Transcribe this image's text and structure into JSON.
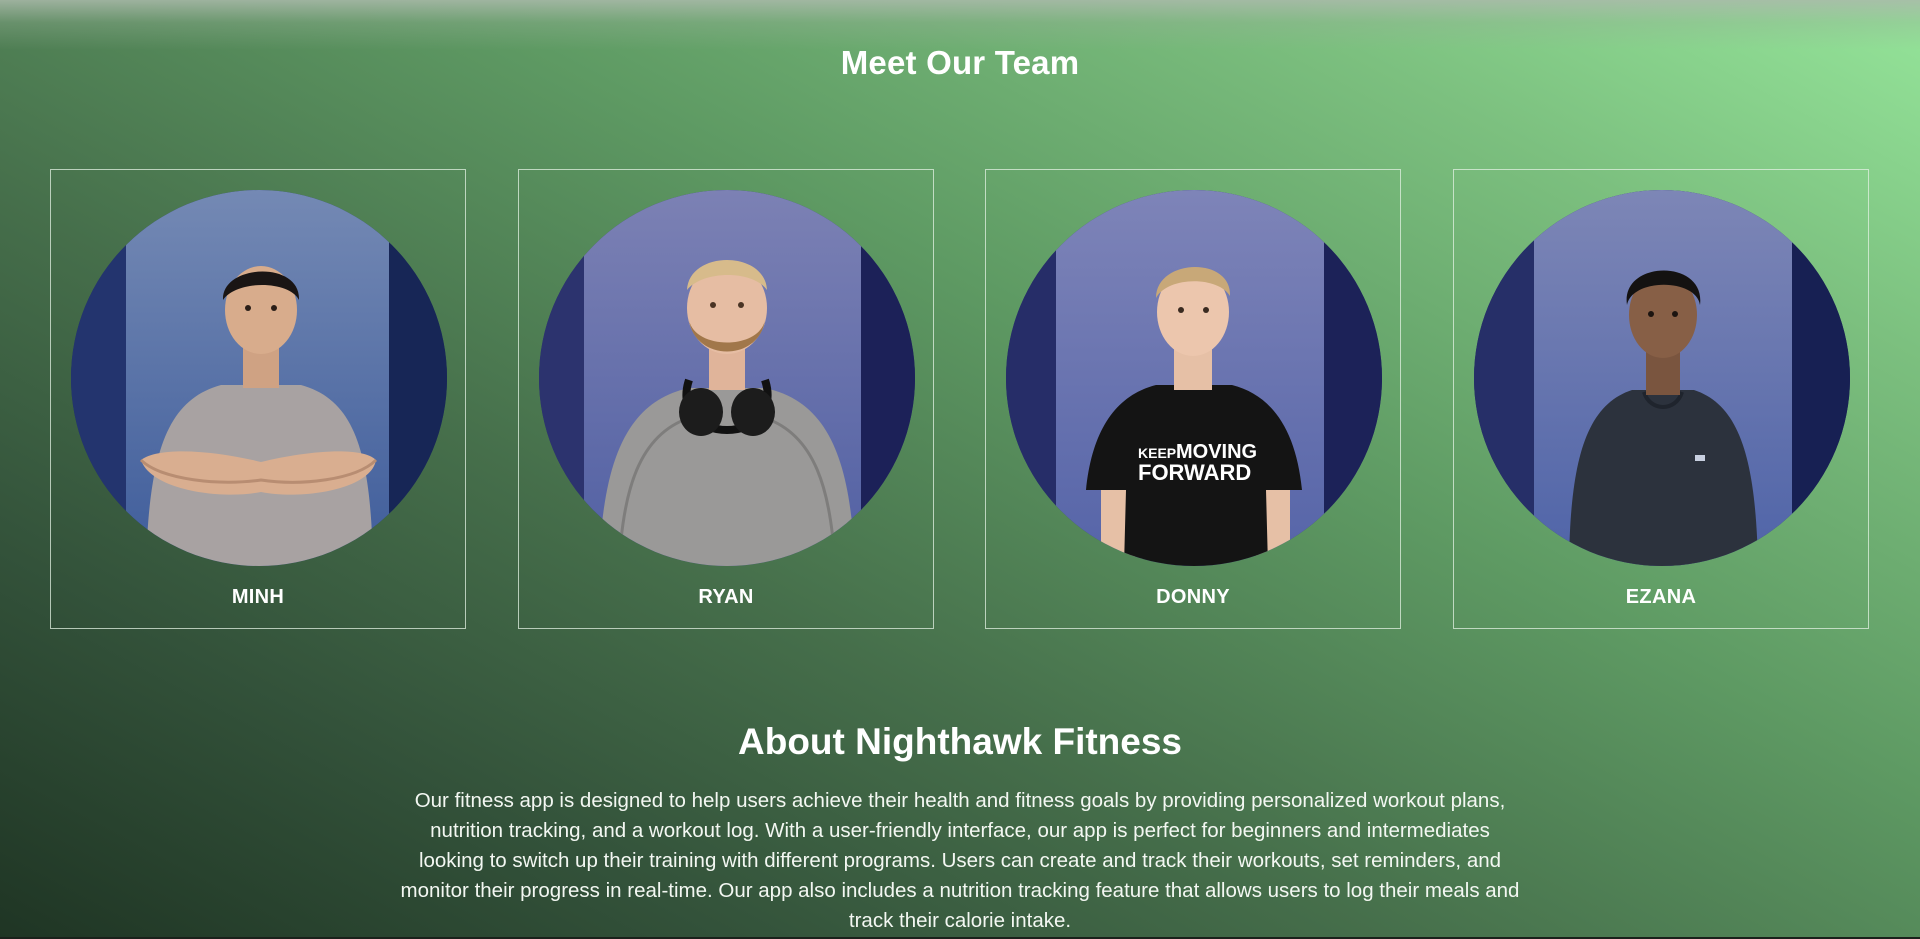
{
  "team": {
    "title": "Meet Our Team",
    "members": [
      {
        "name": "MINH"
      },
      {
        "name": "RYAN"
      },
      {
        "name": "DONNY",
        "shirt_text": [
          "KEEP",
          "MOVING",
          "FORWARD"
        ]
      },
      {
        "name": "EZANA"
      }
    ]
  },
  "about": {
    "title": "About Nighthawk Fitness",
    "text": "Our fitness app is designed to help users achieve their health and fitness goals by providing personalized workout plans, nutrition tracking, and a workout log. With a user-friendly interface, our app is perfect for beginners and intermediates looking to switch up their training with different programs. Users can create and track their workouts, set reminders, and monitor their progress in real-time. Our app also includes a nutrition tracking feature that allows users to log their meals and track their calorie intake."
  },
  "colors": {
    "background_top_right": "#95e59a",
    "background_bottom_left": "#1f3524",
    "card_border": "#e1f0e1",
    "text": "#ffffff"
  }
}
